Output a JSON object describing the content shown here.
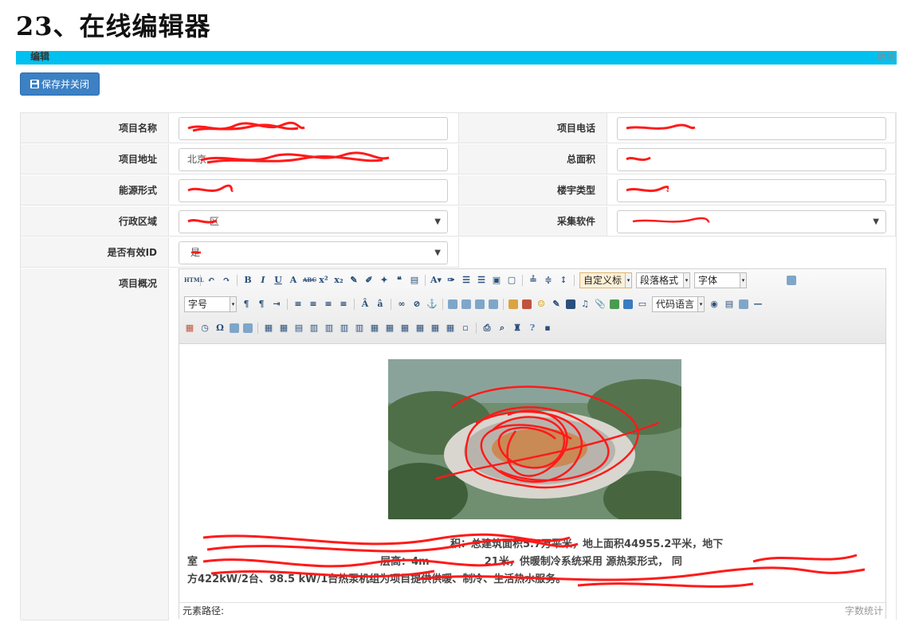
{
  "document": {
    "heading": "23、在线编辑器"
  },
  "panel": {
    "title": "编辑",
    "collapse_label": "收缩"
  },
  "toolbar": {
    "save_label": "保存并关闭"
  },
  "form": {
    "fields": {
      "project_name": {
        "label": "项目名称",
        "value": ""
      },
      "project_phone": {
        "label": "项目电话",
        "value": ""
      },
      "project_address": {
        "label": "项目地址",
        "value": "北京"
      },
      "total_area": {
        "label": "总面积",
        "value": ""
      },
      "energy_form": {
        "label": "能源形式",
        "value": ""
      },
      "building_type": {
        "label": "楼宇类型",
        "value": ""
      },
      "district": {
        "label": "行政区域",
        "value": "区"
      },
      "collection_software": {
        "label": "采集软件",
        "value": ""
      },
      "valid_id": {
        "label": "是否有效ID",
        "value": "是"
      },
      "overview": {
        "label": "项目概况"
      }
    }
  },
  "editor": {
    "combos": {
      "custom_title": "自定义标",
      "paragraph_format": "段落格式",
      "font_family": "字体",
      "font_size": "字号",
      "code_language": "代码语言"
    },
    "content_text": "平米，地上面积44955.2平米，地下室…供暖…层高：4m…21米，供暖制冷系统采用…源热泵形式，…同方422kW/2台、98.5 kW/1台热泵机组为项目提供供暖、制冷、生活热水服务。",
    "content_fragments": {
      "area_note": "积：总建筑面积5.7万平米，地上面积44955.2平米，地下",
      "line2_start": "室",
      "line2_mid": "层高：4m",
      "line2_end": "21米，供暖制冷系统采用",
      "line2_tail": "源热泵形式，",
      "line2_last": "同",
      "line3": "方422kW/2台、98.5 kW/1台热泵机组为项目提供供暖、制冷、生活热水服务。"
    },
    "status": {
      "path_label": "元素路径:",
      "word_count_label": "字数统计"
    }
  },
  "colors": {
    "accent": "#00c1f0",
    "button": "#3c81c4",
    "redaction": "#ff1a1a"
  }
}
